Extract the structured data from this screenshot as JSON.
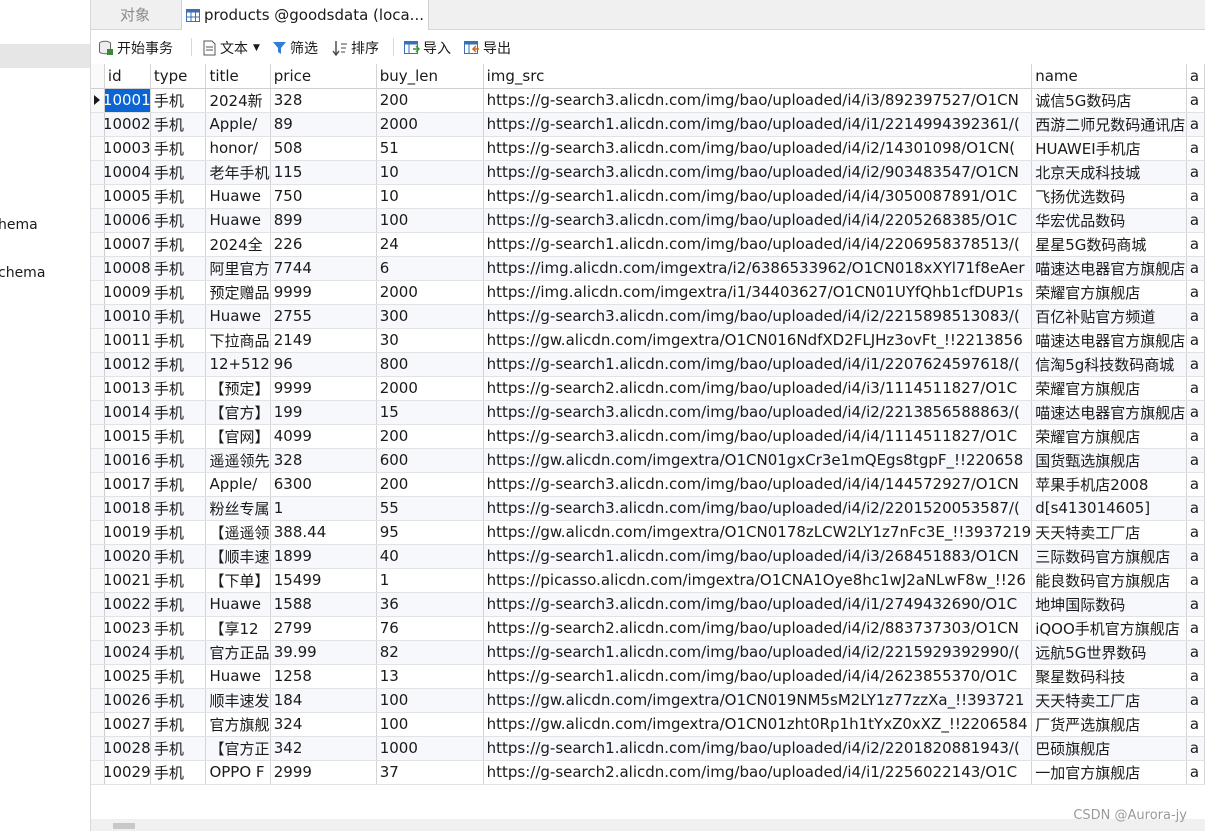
{
  "sidebar": {
    "items": [
      {
        "label": "hema"
      },
      {
        "label": "chema"
      }
    ]
  },
  "tabs": [
    {
      "label": "对象",
      "active": false
    },
    {
      "label": "products @goodsdata (loca...",
      "active": true,
      "icon": "table-icon"
    }
  ],
  "toolbar": {
    "begin_transaction": "开始事务",
    "text": "文本",
    "filter": "筛选",
    "sort": "排序",
    "import": "导入",
    "export": "导出"
  },
  "grid": {
    "columns": [
      "id",
      "type",
      "title",
      "price",
      "buy_len",
      "img_src",
      "name",
      "a"
    ],
    "rows": [
      [
        "10001",
        "手机",
        "2024新",
        "328",
        "200",
        "https://g-search3.alicdn.com/img/bao/uploaded/i4/i3/892397527/O1CN",
        "诚信5G数码店",
        "a"
      ],
      [
        "10002",
        "手机",
        "Apple/",
        "89",
        "2000",
        "https://g-search1.alicdn.com/img/bao/uploaded/i4/i1/2214994392361/(",
        "西游二师兄数码通讯店",
        "a"
      ],
      [
        "10003",
        "手机",
        "honor/",
        "508",
        "51",
        "https://g-search3.alicdn.com/img/bao/uploaded/i4/i2/14301098/O1CN(",
        "HUAWEI手机店",
        "a"
      ],
      [
        "10004",
        "手机",
        "老年手机",
        "115",
        "10",
        "https://g-search3.alicdn.com/img/bao/uploaded/i4/i2/903483547/O1CN",
        "北京天成科技城",
        "a"
      ],
      [
        "10005",
        "手机",
        "Huawe",
        "750",
        "10",
        "https://g-search1.alicdn.com/img/bao/uploaded/i4/i4/3050087891/O1C",
        "飞扬优选数码",
        "a"
      ],
      [
        "10006",
        "手机",
        "Huawe",
        "899",
        "100",
        "https://g-search3.alicdn.com/img/bao/uploaded/i4/i4/2205268385/O1C",
        "华宏优品数码",
        "a"
      ],
      [
        "10007",
        "手机",
        "2024全",
        "226",
        "24",
        "https://g-search1.alicdn.com/img/bao/uploaded/i4/i4/2206958378513/(",
        "星星5G数码商城",
        "a"
      ],
      [
        "10008",
        "手机",
        "阿里官方",
        "7744",
        "6",
        "https://img.alicdn.com/imgextra/i2/6386533962/O1CN018xXYl71f8eAer",
        "喵速达电器官方旗舰店",
        "a"
      ],
      [
        "10009",
        "手机",
        "预定赠品",
        "9999",
        "2000",
        "https://img.alicdn.com/imgextra/i1/34403627/O1CN01UYfQhb1cfDUP1s",
        "荣耀官方旗舰店",
        "a"
      ],
      [
        "10010",
        "手机",
        "Huawe",
        "2755",
        "300",
        "https://g-search3.alicdn.com/img/bao/uploaded/i4/i2/2215898513083/(",
        "百亿补贴官方频道",
        "a"
      ],
      [
        "10011",
        "手机",
        "下拉商品",
        "2149",
        "30",
        "https://gw.alicdn.com/imgextra/O1CN016NdfXD2FLJHz3ovFt_!!2213856",
        "喵速达电器官方旗舰店",
        "a"
      ],
      [
        "10012",
        "手机",
        "12+512",
        "96",
        "800",
        "https://g-search1.alicdn.com/img/bao/uploaded/i4/i1/2207624597618/(",
        "信淘5g科技数码商城",
        "a"
      ],
      [
        "10013",
        "手机",
        "【预定】",
        "9999",
        "2000",
        "https://g-search2.alicdn.com/img/bao/uploaded/i4/i3/1114511827/O1C",
        "荣耀官方旗舰店",
        "a"
      ],
      [
        "10014",
        "手机",
        "【官方】",
        "199",
        "15",
        "https://g-search3.alicdn.com/img/bao/uploaded/i4/i2/2213856588863/(",
        "喵速达电器官方旗舰店",
        "a"
      ],
      [
        "10015",
        "手机",
        "【官网】",
        "4099",
        "200",
        "https://g-search3.alicdn.com/img/bao/uploaded/i4/i4/1114511827/O1C",
        "荣耀官方旗舰店",
        "a"
      ],
      [
        "10016",
        "手机",
        "遥遥领先",
        "328",
        "600",
        "https://gw.alicdn.com/imgextra/O1CN01gxCr3e1mQEgs8tgpF_!!220658",
        "国货甄选旗舰店",
        "a"
      ],
      [
        "10017",
        "手机",
        "Apple/",
        "6300",
        "200",
        "https://g-search3.alicdn.com/img/bao/uploaded/i4/i4/144572927/O1CN",
        "苹果手机店2008",
        "a"
      ],
      [
        "10018",
        "手机",
        "粉丝专属",
        "1",
        "55",
        "https://g-search3.alicdn.com/img/bao/uploaded/i4/i2/2201520053587/(",
        "d[s413014605]",
        "a"
      ],
      [
        "10019",
        "手机",
        "【遥遥领",
        "388.44",
        "95",
        "https://gw.alicdn.com/imgextra/O1CN0178zLCW2LY1z7nFc3E_!!3937219",
        "天天特卖工厂店",
        "a"
      ],
      [
        "10020",
        "手机",
        "【顺丰速",
        "1899",
        "40",
        "https://g-search1.alicdn.com/img/bao/uploaded/i4/i3/268451883/O1CN",
        "三际数码官方旗舰店",
        "a"
      ],
      [
        "10021",
        "手机",
        "【下单】",
        "15499",
        "1",
        "https://picasso.alicdn.com/imgextra/O1CNA1Oye8hc1wJ2aNLwF8w_!!26",
        "能良数码官方旗舰店",
        "a"
      ],
      [
        "10022",
        "手机",
        "Huawe",
        "1588",
        "36",
        "https://g-search3.alicdn.com/img/bao/uploaded/i4/i1/2749432690/O1C",
        "地坤国际数码",
        "a"
      ],
      [
        "10023",
        "手机",
        "【享12",
        "2799",
        "76",
        "https://g-search2.alicdn.com/img/bao/uploaded/i4/i2/883737303/O1CN",
        "iQOO手机官方旗舰店",
        "a"
      ],
      [
        "10024",
        "手机",
        "官方正品",
        "39.99",
        "82",
        "https://g-search1.alicdn.com/img/bao/uploaded/i4/i2/2215929392990/(",
        "远航5G世界数码",
        "a"
      ],
      [
        "10025",
        "手机",
        "Huawe",
        "1258",
        "13",
        "https://g-search1.alicdn.com/img/bao/uploaded/i4/i4/2623855370/O1C",
        "聚星数码科技",
        "a"
      ],
      [
        "10026",
        "手机",
        "顺丰速发",
        "184",
        "100",
        "https://gw.alicdn.com/imgextra/O1CN019NM5sM2LY1z77zzXa_!!393721",
        "天天特卖工厂店",
        "a"
      ],
      [
        "10027",
        "手机",
        "官方旗舰",
        "324",
        "100",
        "https://gw.alicdn.com/imgextra/O1CN01zht0Rp1h1tYxZ0xXZ_!!2206584",
        "厂货严选旗舰店",
        "a"
      ],
      [
        "10028",
        "手机",
        "【官方正",
        "342",
        "1000",
        "https://g-search1.alicdn.com/img/bao/uploaded/i4/i2/2201820881943/(",
        "巴硕旗舰店",
        "a"
      ],
      [
        "10029",
        "手机",
        "OPPO F",
        "2999",
        "37",
        "https://g-search2.alicdn.com/img/bao/uploaded/i4/i1/2256022143/O1C",
        "一加官方旗舰店",
        "a"
      ]
    ],
    "selected_row": 0
  },
  "watermark": "CSDN @Aurora-jy",
  "colors": {
    "selection": "#0a64d2",
    "tab_bar": "#f0f0f0",
    "grid_line": "#d4d4d4"
  }
}
